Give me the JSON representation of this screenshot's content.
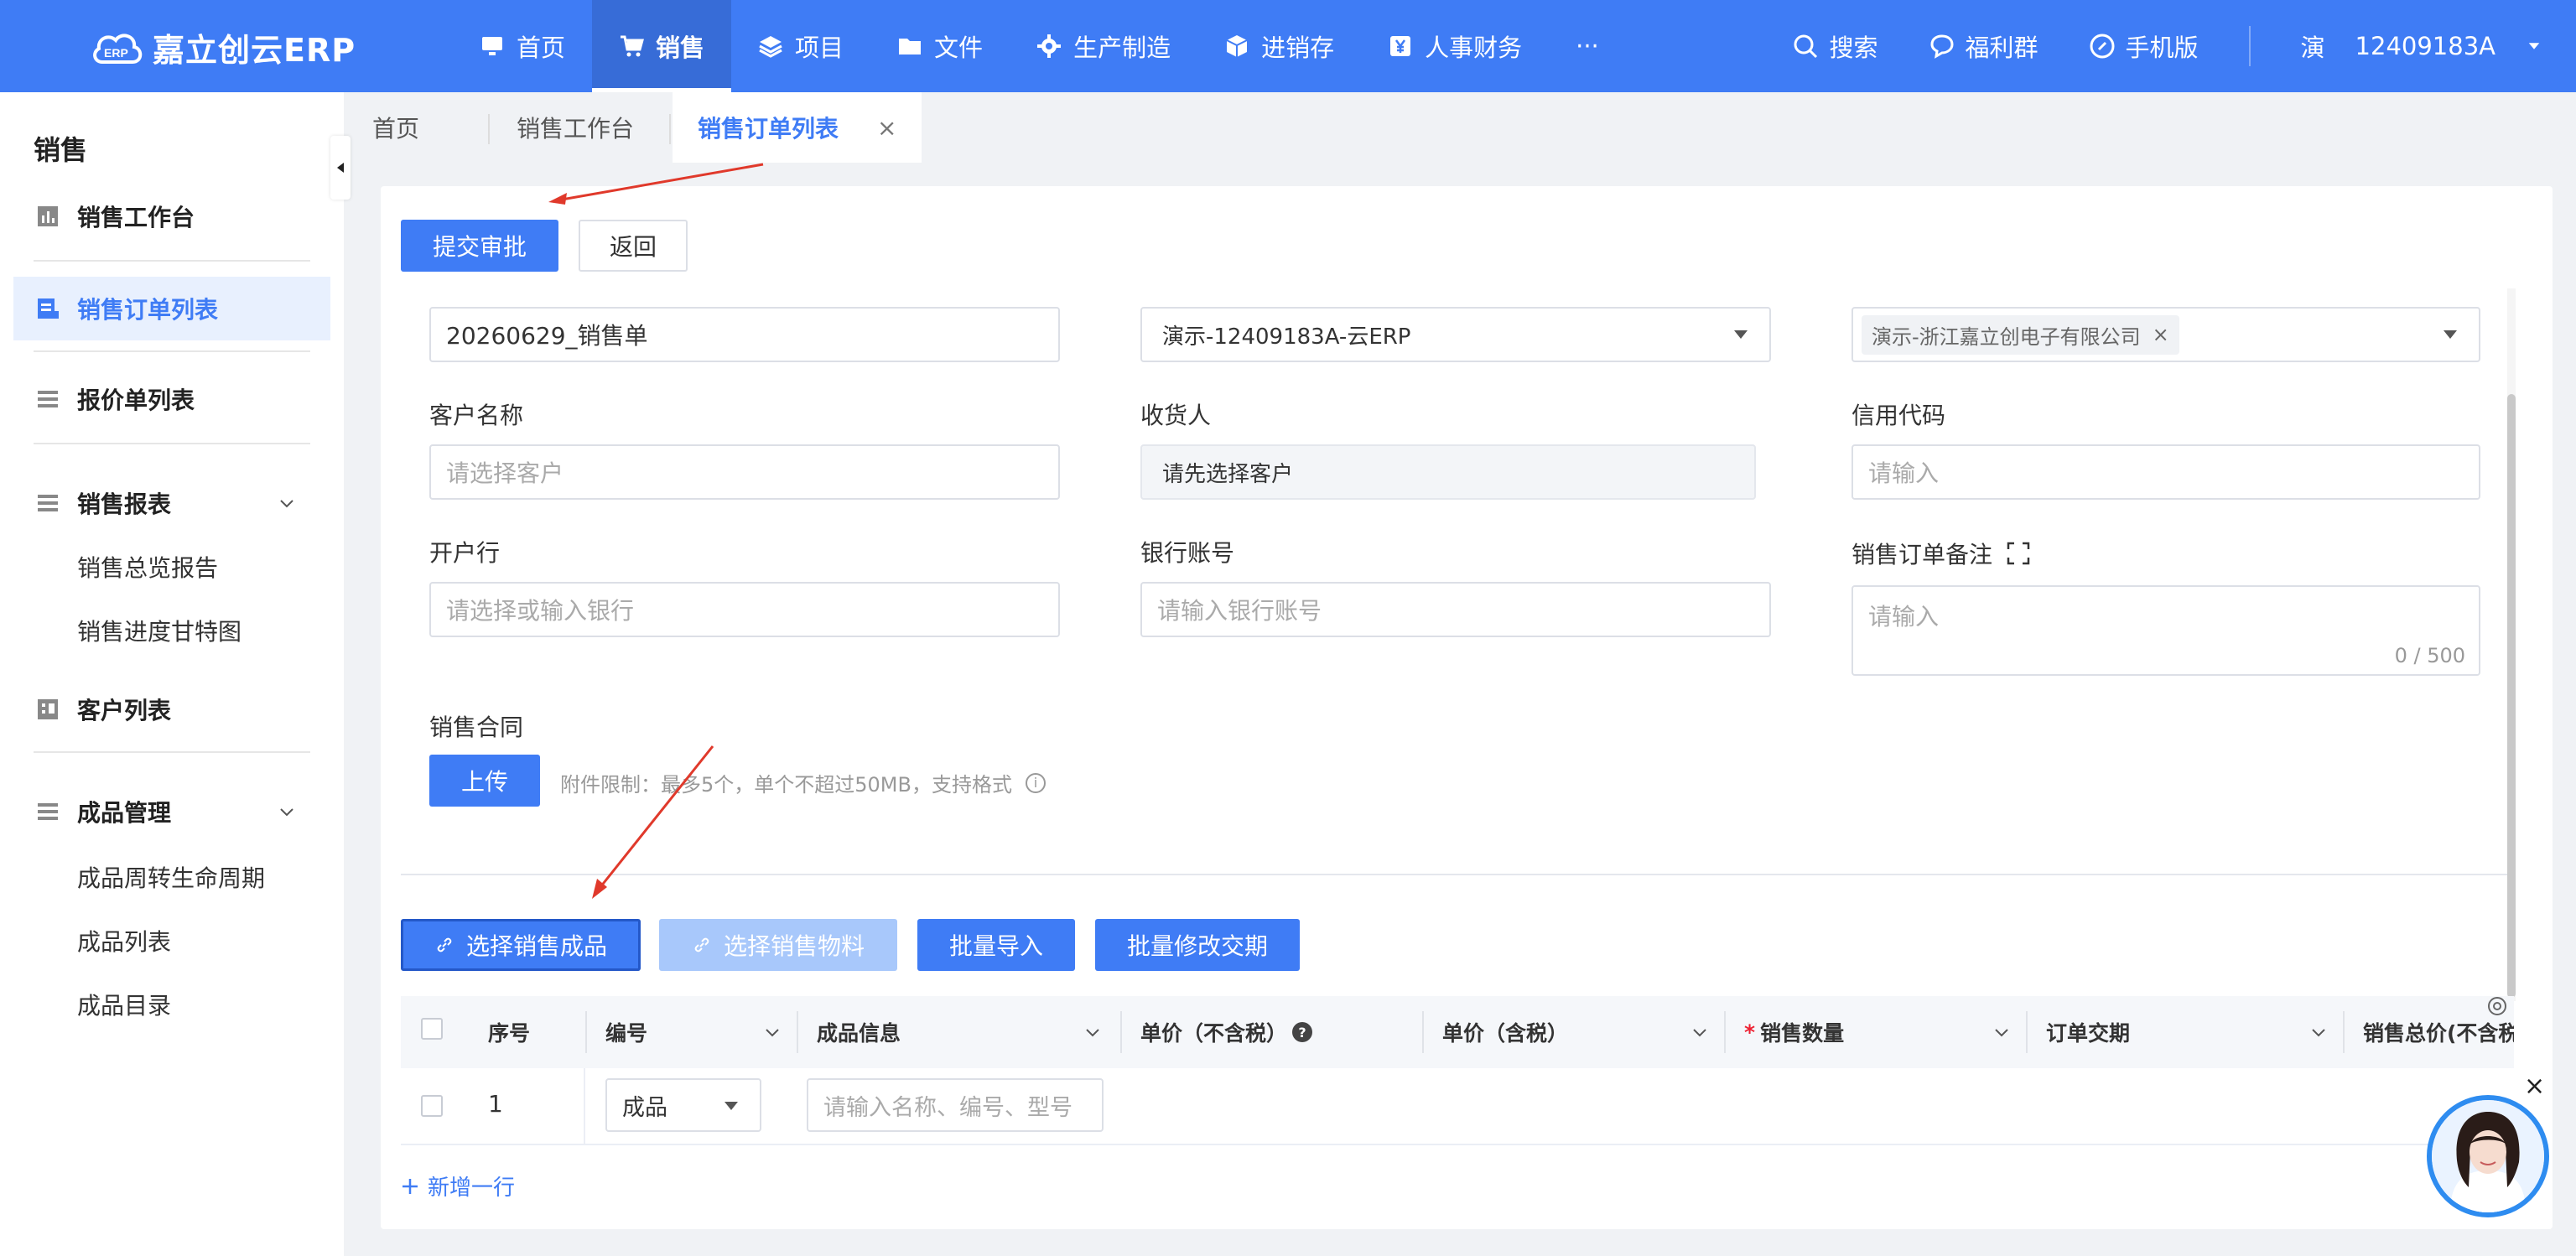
{
  "app": {
    "logo_text": "嘉立创云ERP",
    "logo_badge": "ERP",
    "brand_color": "#3f7cf5"
  },
  "nav": [
    {
      "label": "首页",
      "icon": "monitor-icon",
      "active": false
    },
    {
      "label": "销售",
      "icon": "cart-icon",
      "active": true
    },
    {
      "label": "项目",
      "icon": "layers-icon",
      "active": false
    },
    {
      "label": "文件",
      "icon": "folder-icon",
      "active": false
    },
    {
      "label": "生产制造",
      "icon": "cog-icon",
      "active": false
    },
    {
      "label": "进销存",
      "icon": "box-icon",
      "active": false
    },
    {
      "label": "人事财务",
      "icon": "yen-icon",
      "active": false
    },
    {
      "label": "···",
      "icon": "more-icon",
      "active": false
    }
  ],
  "top_right": {
    "search": "搜索",
    "welfare": "福利群",
    "mobile": "手机版",
    "user_avatar": "演",
    "account": "12409183A"
  },
  "sidebar": {
    "title": "销售",
    "items": [
      {
        "label": "销售工作台",
        "icon": "chart-icon"
      },
      {
        "label": "销售订单列表",
        "icon": "order-list-icon",
        "active": true
      },
      {
        "label": "报价单列表",
        "icon": "list-icon"
      },
      {
        "label": "销售报表",
        "icon": "report-icon",
        "expandable": true
      },
      {
        "label": "客户列表",
        "icon": "customer-icon"
      },
      {
        "label": "成品管理",
        "icon": "product-icon",
        "expandable": true
      }
    ],
    "report_sub": [
      "销售总览报告",
      "销售进度甘特图"
    ],
    "product_sub": [
      "成品周转生命周期",
      "成品列表",
      "成品目录"
    ]
  },
  "tabs": [
    {
      "label": "首页"
    },
    {
      "label": "销售工作台"
    },
    {
      "label": "销售订单列表",
      "active": true,
      "close": "×"
    }
  ],
  "toolbar": {
    "submit": "提交审批",
    "back": "返回"
  },
  "form": {
    "order_name": "20260629_销售单",
    "company": "演示-12409183A-云ERP",
    "org_tag": "演示-浙江嘉立创电子有限公司",
    "tag_close": "×",
    "customer_label": "客户名称",
    "customer_placeholder": "请选择客户",
    "receiver_label": "收货人",
    "receiver_value": "请先选择客户",
    "credit_label": "信用代码",
    "credit_placeholder": "请输入",
    "bank_label": "开户行",
    "bank_placeholder": "请选择或输入银行",
    "account_label": "银行账号",
    "account_placeholder": "请输入银行账号",
    "remark_label": "销售订单备注",
    "remark_placeholder": "请输入",
    "remark_counter": "0 / 500",
    "contract_label": "销售合同",
    "upload": "上传",
    "upload_hint": "附件限制：最多5个，单个不超过50MB，支持格式",
    "info_mark": "i"
  },
  "actions": {
    "select_product": "选择销售成品",
    "select_material": "选择销售物料",
    "batch_import": "批量导入",
    "batch_edit": "批量修改交期"
  },
  "table": {
    "headers": [
      "序号",
      "编号",
      "成品信息",
      "单价（不含税）",
      "单价（含税）",
      "销售数量",
      "订单交期",
      "销售总价(不含税"
    ],
    "help_mark": "?",
    "rows": [
      {
        "index": "1",
        "code": "成品",
        "info_placeholder": "请输入名称、编号、型号"
      }
    ],
    "add_row": "新增一行"
  },
  "misc": {
    "close_x": "×"
  }
}
